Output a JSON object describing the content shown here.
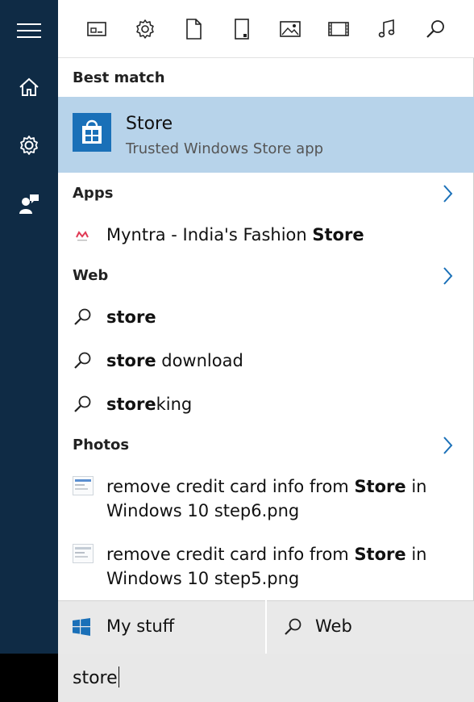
{
  "filters": [
    {
      "name": "apps-filter-icon"
    },
    {
      "name": "settings-filter-icon"
    },
    {
      "name": "documents-filter-icon"
    },
    {
      "name": "folders-filter-icon"
    },
    {
      "name": "photos-filter-icon"
    },
    {
      "name": "videos-filter-icon"
    },
    {
      "name": "music-filter-icon"
    },
    {
      "name": "web-filter-icon"
    }
  ],
  "rail": {
    "items": [
      "hamburger-icon",
      "home-icon",
      "gear-icon",
      "feedback-icon"
    ]
  },
  "best_match": {
    "heading": "Best match",
    "title": "Store",
    "subtitle": "Trusted Windows Store app",
    "highlight_color": "#b7d3ea",
    "tile_color": "#1a70b8"
  },
  "apps": {
    "heading": "Apps",
    "items": [
      {
        "prefix": "Myntra - India's Fashion ",
        "bold": "Store",
        "suffix": ""
      }
    ]
  },
  "web": {
    "heading": "Web",
    "items": [
      {
        "bold": "store",
        "suffix": ""
      },
      {
        "bold": "store",
        "suffix": " download"
      },
      {
        "bold": "store",
        "suffix": "king"
      }
    ]
  },
  "photos": {
    "heading": "Photos",
    "items": [
      {
        "line1_prefix": "remove credit card info from ",
        "line1_bold": "Store",
        "line1_suffix": " in",
        "line2": "Windows 10 step6.png"
      },
      {
        "line1_prefix": "remove credit card info from ",
        "line1_bold": "Store",
        "line1_suffix": " in",
        "line2": "Windows 10 step5.png"
      }
    ]
  },
  "scope": {
    "my_stuff": "My stuff",
    "web": "Web"
  },
  "search": {
    "value": "store"
  },
  "colors": {
    "rail": "#0f2b45",
    "accent": "#1a70b8"
  }
}
